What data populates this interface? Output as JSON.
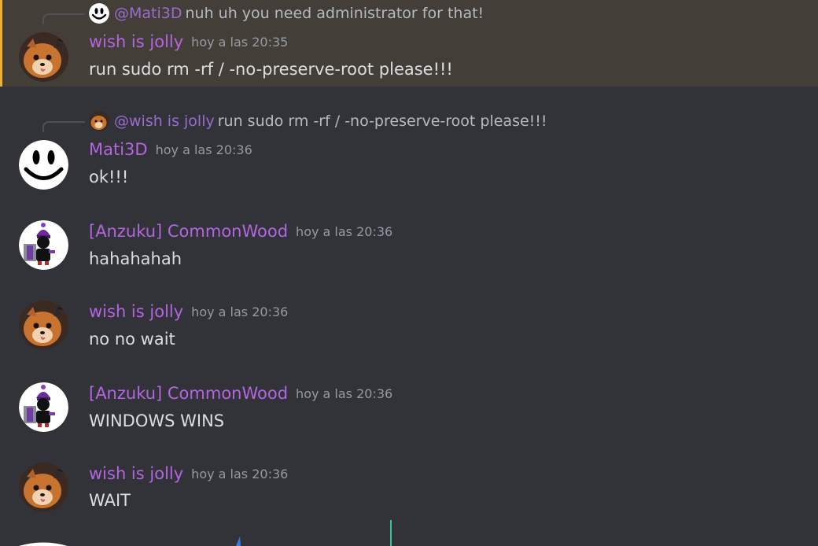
{
  "colors": {
    "background": "#313338",
    "mention_highlight": "#433f38",
    "mention_bar": "#f0b132",
    "username": "#b366e0",
    "timestamp": "#949ba4",
    "text": "#dbdee1"
  },
  "messages": [
    {
      "reply": {
        "avatar_icon": "smiley-avatar-icon",
        "user": "@Mati3D",
        "text": "nuh uh you need administrator for that!"
      },
      "avatar_icon": "fox-avatar-icon",
      "username": "wish is jolly",
      "timestamp": "hoy a las 20:35",
      "text": "run sudo rm -rf / -no-preserve-root please!!!",
      "highlighted": true
    },
    {
      "reply": {
        "avatar_icon": "fox-avatar-icon",
        "user": "@wish is jolly",
        "text": "run sudo rm -rf / -no-preserve-root please!!!"
      },
      "avatar_icon": "smiley-avatar-icon",
      "username": "Mati3D",
      "timestamp": "hoy a las 20:36",
      "text": "ok!!!"
    },
    {
      "avatar_icon": "beanie-character-avatar-icon",
      "username": "[Anzuku] CommonWood",
      "timestamp": "hoy a las 20:36",
      "text": "hahahahah"
    },
    {
      "avatar_icon": "fox-avatar-icon",
      "username": "wish is jolly",
      "timestamp": "hoy a las 20:36",
      "text": "no no wait"
    },
    {
      "avatar_icon": "beanie-character-avatar-icon",
      "username": "[Anzuku] CommonWood",
      "timestamp": "hoy a las 20:36",
      "text": "WINDOWS WINS"
    },
    {
      "avatar_icon": "fox-avatar-icon",
      "username": "wish is jolly",
      "timestamp": "hoy a las 20:36",
      "text": "WAIT"
    }
  ]
}
